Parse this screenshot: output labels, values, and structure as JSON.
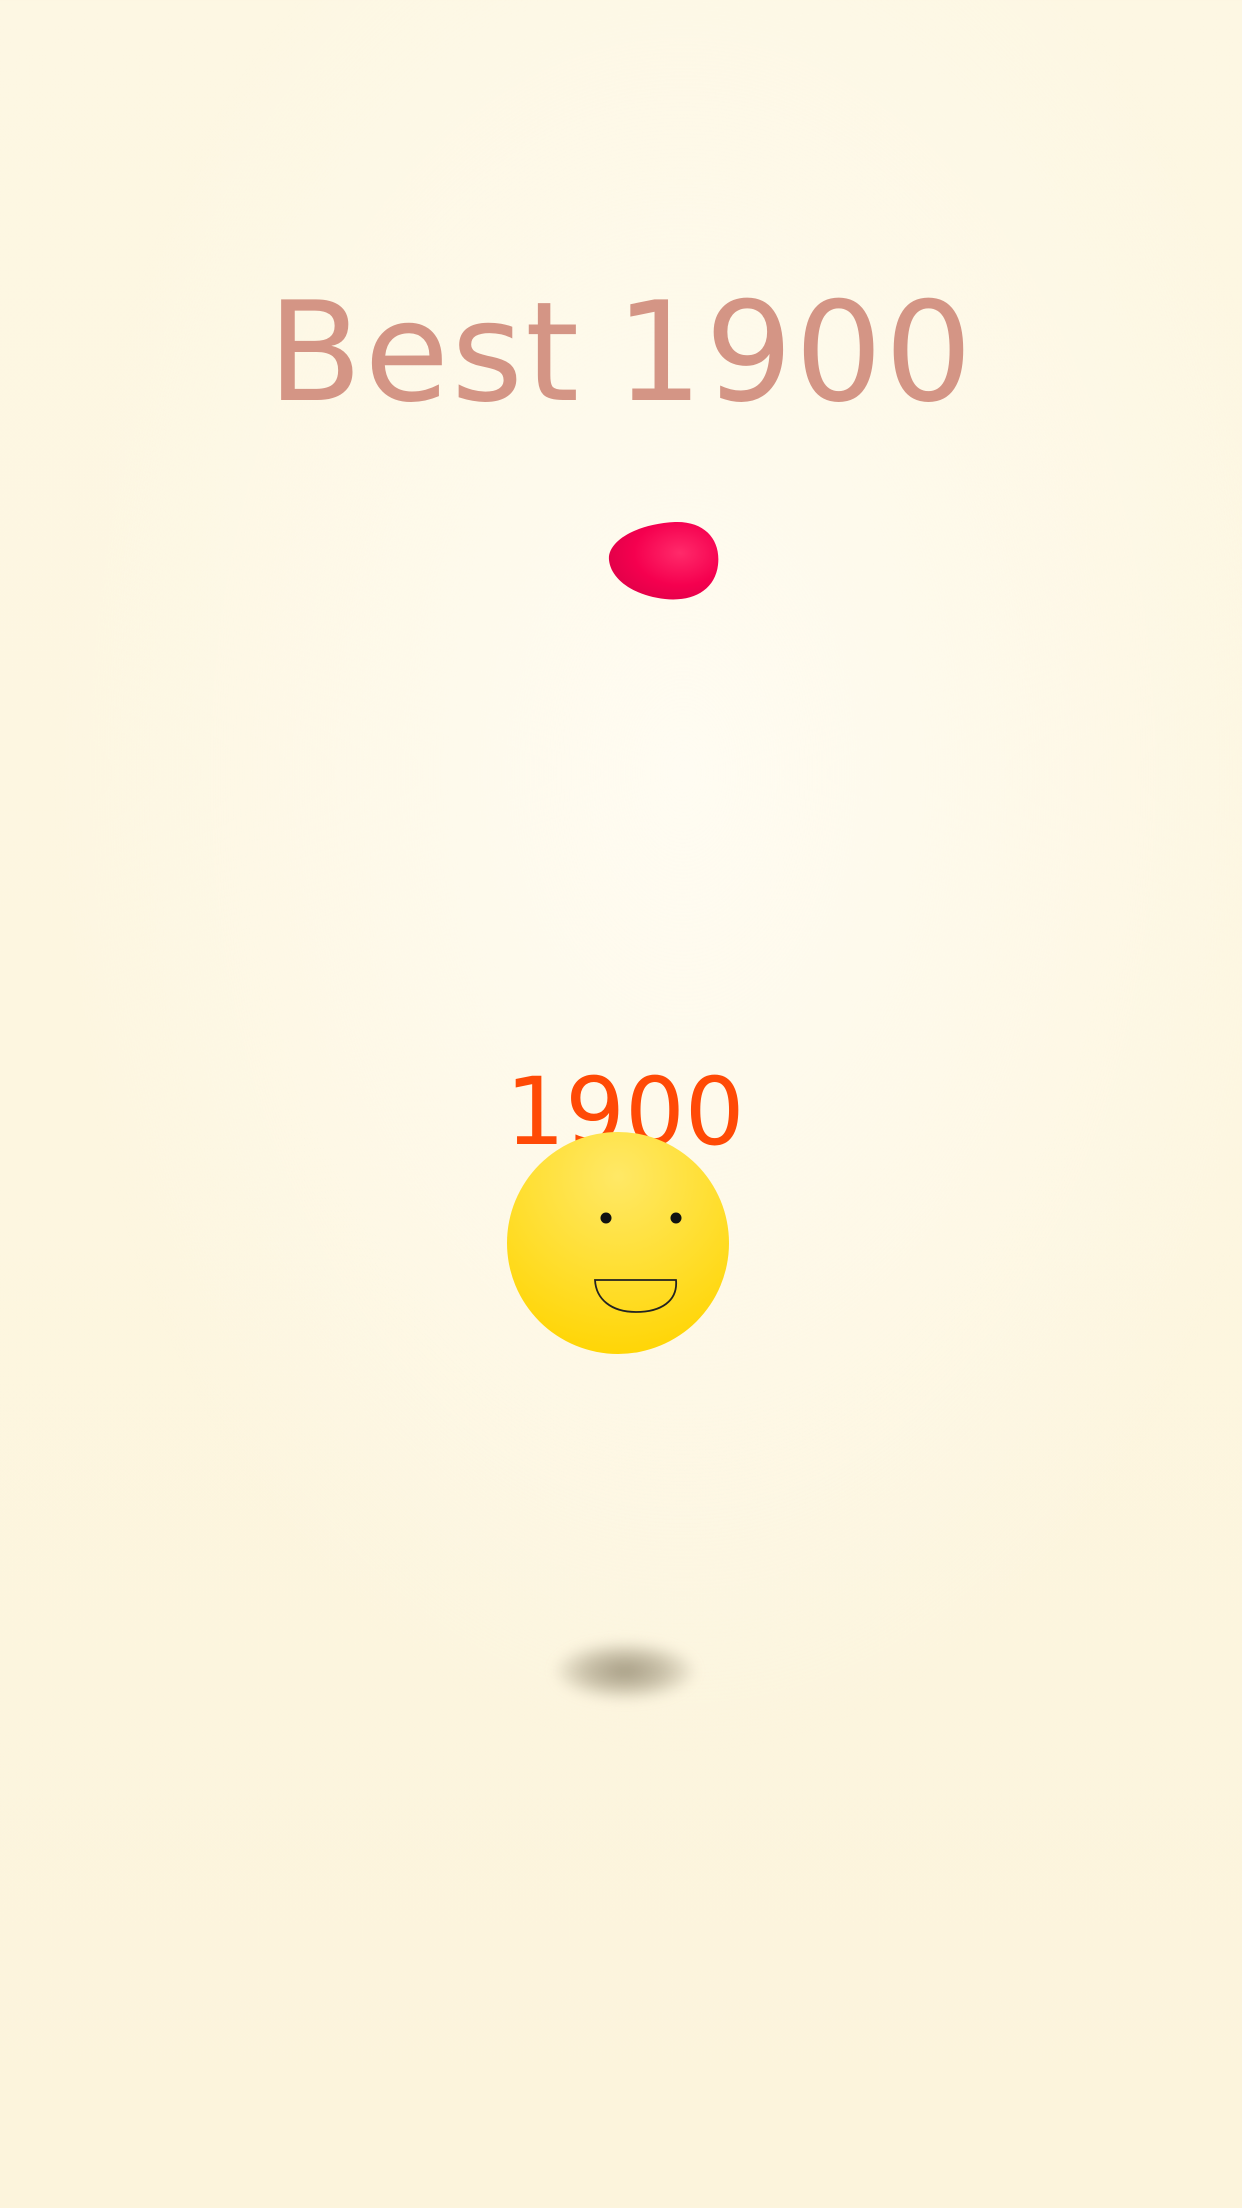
{
  "hud": {
    "best_label": "Best",
    "best_value": "1900",
    "current_score": "1900"
  },
  "colors": {
    "best_text": "#d49585",
    "score_text": "#ff4a06",
    "ball": "#ffdb1f",
    "drop": "#f5004f",
    "background": "#fdf7e3"
  },
  "icons": {
    "player": "smiley-ball-icon",
    "obstacle": "red-drop-icon"
  }
}
